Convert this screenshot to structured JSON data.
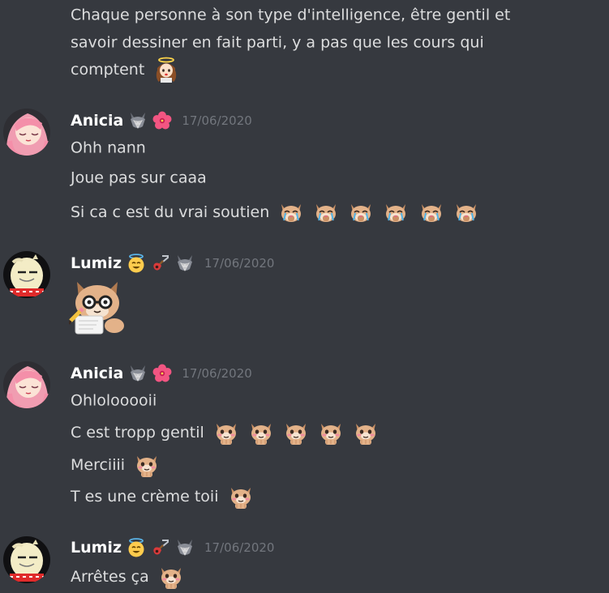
{
  "messages": {
    "m0": {
      "line1": "Chaque personne à son type d'intelligence, être gentil et",
      "line2": "savoir dessiner en fait parti, y a pas que les cours qui",
      "line3": "comptent"
    },
    "m1": {
      "username": "Anicia",
      "timestamp": "17/06/2020",
      "line1": "Ohh nann",
      "line2": "Joue pas sur caaa",
      "line3": "Si ca c est du vrai soutien"
    },
    "m2": {
      "username": "Lumiz",
      "timestamp": "17/06/2020"
    },
    "m3": {
      "username": "Anicia",
      "timestamp": "17/06/2020",
      "line1": "Ohlolooooii",
      "line2": "C est tropp gentil",
      "line3": "Merciiii",
      "line4": "T es une crème toii"
    },
    "m4": {
      "username": "Lumiz",
      "timestamp": "17/06/2020",
      "line1": "Arrêtes ça"
    }
  },
  "colors": {
    "background": "#36393f",
    "text": "#dcddde",
    "username": "#ffffff",
    "timestamp": "#72767d"
  },
  "icons": {
    "wolf_badge": "wolf-icon",
    "flower_badge": "hibiscus-icon",
    "halo_badge": "halo-smile-icon",
    "guitar_badge": "guitar-icon",
    "crying_cat_emoji": "crying-cat-icon",
    "blushing_cat_emoji": "blushing-cat-icon",
    "reading_cat_sticker": "reading-cat-sticker",
    "angel_girl_emoji": "angel-girl-icon"
  }
}
